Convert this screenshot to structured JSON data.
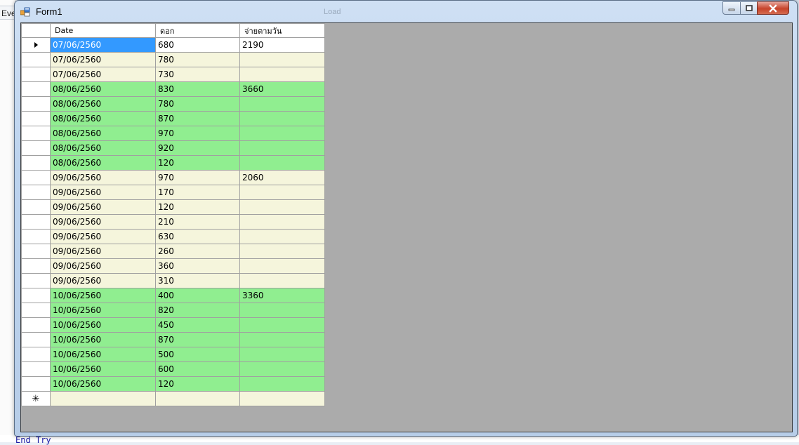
{
  "background": {
    "ide_tab_text": "Eve",
    "code_line": "End Try"
  },
  "window": {
    "title": "Form1",
    "ghost_title": "Load",
    "icon": "winforms-app-icon",
    "controls": {
      "minimize_icon": "minimize-icon",
      "maximize_icon": "restore-icon",
      "close_icon": "close-icon"
    }
  },
  "grid": {
    "columns": [
      "Date",
      "ดอก",
      "จ่ายตามวัน"
    ],
    "rows": [
      {
        "date": "07/06/2560",
        "value": "680",
        "pay": "2190",
        "color": "first"
      },
      {
        "date": "07/06/2560",
        "value": "780",
        "pay": "",
        "color": "cream"
      },
      {
        "date": "07/06/2560",
        "value": "730",
        "pay": "",
        "color": "cream"
      },
      {
        "date": "08/06/2560",
        "value": "830",
        "pay": "3660",
        "color": "green"
      },
      {
        "date": "08/06/2560",
        "value": "780",
        "pay": "",
        "color": "green"
      },
      {
        "date": "08/06/2560",
        "value": "870",
        "pay": "",
        "color": "green"
      },
      {
        "date": "08/06/2560",
        "value": "970",
        "pay": "",
        "color": "green"
      },
      {
        "date": "08/06/2560",
        "value": "920",
        "pay": "",
        "color": "green"
      },
      {
        "date": "08/06/2560",
        "value": "120",
        "pay": "",
        "color": "green"
      },
      {
        "date": "09/06/2560",
        "value": "970",
        "pay": "2060",
        "color": "cream"
      },
      {
        "date": "09/06/2560",
        "value": "170",
        "pay": "",
        "color": "cream"
      },
      {
        "date": "09/06/2560",
        "value": "120",
        "pay": "",
        "color": "cream"
      },
      {
        "date": "09/06/2560",
        "value": "210",
        "pay": "",
        "color": "cream"
      },
      {
        "date": "09/06/2560",
        "value": "630",
        "pay": "",
        "color": "cream"
      },
      {
        "date": "09/06/2560",
        "value": "260",
        "pay": "",
        "color": "cream"
      },
      {
        "date": "09/06/2560",
        "value": "360",
        "pay": "",
        "color": "cream"
      },
      {
        "date": "09/06/2560",
        "value": "310",
        "pay": "",
        "color": "cream"
      },
      {
        "date": "10/06/2560",
        "value": "400",
        "pay": "3360",
        "color": "green"
      },
      {
        "date": "10/06/2560",
        "value": "820",
        "pay": "",
        "color": "green"
      },
      {
        "date": "10/06/2560",
        "value": "450",
        "pay": "",
        "color": "green"
      },
      {
        "date": "10/06/2560",
        "value": "870",
        "pay": "",
        "color": "green"
      },
      {
        "date": "10/06/2560",
        "value": "500",
        "pay": "",
        "color": "green"
      },
      {
        "date": "10/06/2560",
        "value": "600",
        "pay": "",
        "color": "green"
      },
      {
        "date": "10/06/2560",
        "value": "120",
        "pay": "",
        "color": "green"
      }
    ],
    "current_row_indicator": "row-arrow-icon",
    "new_row_indicator": "new-row-star-icon",
    "colors": {
      "green": "#90ee90",
      "cream": "#f5f5dc",
      "selection": "#3399ff",
      "client_background": "#ababab"
    }
  }
}
